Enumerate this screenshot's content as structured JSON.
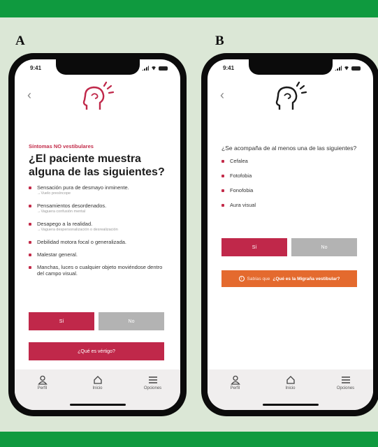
{
  "panels": {
    "a": {
      "letter": "A",
      "status_time": "9:41",
      "subtitle": "Síntomas NO vestibulares",
      "title": "¿El paciente muestra alguna de las siguientes?",
      "items": [
        {
          "text": "Sensación pura de desmayo inminente.",
          "sub": "→Vuelo presíncope"
        },
        {
          "text": "Pensamientos desordenados.",
          "sub": "→Vaguera confusión mental"
        },
        {
          "text": "Desapego a la realidad.",
          "sub": "→Vaguera despersonalización o desrealización"
        },
        {
          "text": "Debilidad motora focal o generalizada.",
          "sub": ""
        },
        {
          "text": "Malestar general.",
          "sub": ""
        },
        {
          "text": "Manchas, luces o cualquier objeto moviéndose dentro del campo visual.",
          "sub": ""
        }
      ],
      "yes_label": "Sí",
      "no_label": "No",
      "wide_button": "¿Qué es vértigo?",
      "tabs": [
        {
          "icon": "person-icon",
          "label": "Perfil"
        },
        {
          "icon": "home-icon",
          "label": "Inicio"
        },
        {
          "icon": "menu-icon",
          "label": "Opciones"
        }
      ]
    },
    "b": {
      "letter": "B",
      "status_time": "9:41",
      "question": "¿Se acompaña de al menos una de las siguientes?",
      "items": [
        "Cefalea",
        "Fotofobia",
        "Fonofobia",
        "Aura visual"
      ],
      "yes_label": "Sí",
      "no_label": "No",
      "info_lead": "Sabías que",
      "info_strong": "¿Qué es la Migraña vestibular?",
      "tabs": [
        {
          "icon": "person-icon",
          "label": "Perfil"
        },
        {
          "icon": "home-icon",
          "label": "Inicio"
        },
        {
          "icon": "menu-icon",
          "label": "Opciones"
        }
      ]
    }
  },
  "colors": {
    "band": "#0f9a3f",
    "background": "#dbe7d6",
    "accent_red": "#c0284a",
    "accent_orange": "#e46a2e",
    "neutral_button": "#b3b3b3"
  }
}
